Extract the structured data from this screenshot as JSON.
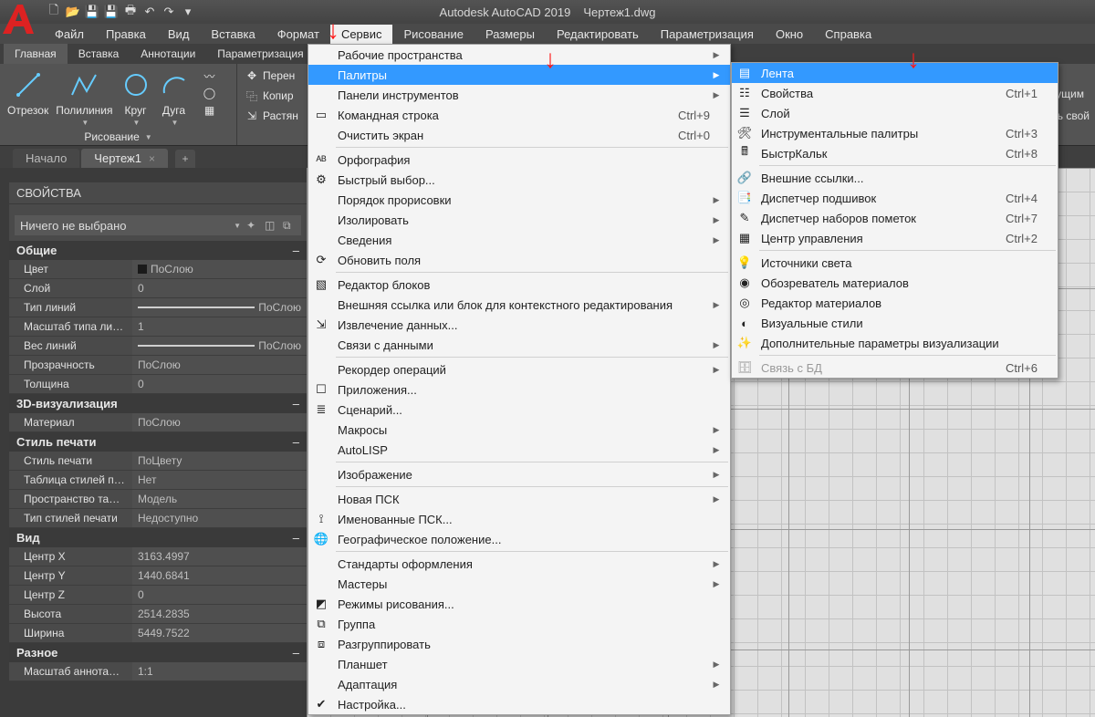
{
  "title": {
    "app": "Autodesk AutoCAD 2019",
    "file": "Чертеж1.dwg"
  },
  "menubar": [
    "Файл",
    "Правка",
    "Вид",
    "Вставка",
    "Формат",
    "Сервис",
    "Рисование",
    "Размеры",
    "Редактировать",
    "Параметризация",
    "Окно",
    "Справка"
  ],
  "menubar_open_index": 5,
  "ribtabs": [
    "Главная",
    "Вставка",
    "Аннотации",
    "Параметризация"
  ],
  "ribbon": {
    "draw": {
      "label": "Рисование",
      "buttons": [
        "Отрезок",
        "Полилиния",
        "Круг",
        "Дуга"
      ]
    },
    "modify": {
      "items": [
        "Перен",
        "Копир",
        "Растян"
      ]
    },
    "layers_hint1": "кущим",
    "layers_hint2": "ль свой"
  },
  "doctabs": {
    "start": "Начало",
    "active": "Чертеж1"
  },
  "props": {
    "title": "СВОЙСТВА",
    "selection": "Ничего не выбрано",
    "sections": {
      "general": "Общие",
      "vis3d": "3D-визуализация",
      "plot": "Стиль печати",
      "view": "Вид",
      "misc": "Разное"
    },
    "general_rows": [
      [
        "Цвет",
        "ПоСлою"
      ],
      [
        "Слой",
        "0"
      ],
      [
        "Тип линий",
        "ПоСлою"
      ],
      [
        "Масштаб типа линий",
        "1"
      ],
      [
        "Вес линий",
        "ПоСлою"
      ],
      [
        "Прозрачность",
        "ПоСлою"
      ],
      [
        "Толщина",
        "0"
      ]
    ],
    "vis3d_rows": [
      [
        "Материал",
        "ПоСлою"
      ]
    ],
    "plot_rows": [
      [
        "Стиль печати",
        "ПоЦвету"
      ],
      [
        "Таблица стилей печ...",
        "Нет"
      ],
      [
        "Пространство табл...",
        "Модель"
      ],
      [
        "Тип стилей печати",
        "Недоступно"
      ]
    ],
    "view_rows": [
      [
        "Центр X",
        "3163.4997"
      ],
      [
        "Центр Y",
        "1440.6841"
      ],
      [
        "Центр Z",
        "0"
      ],
      [
        "Высота",
        "2514.2835"
      ],
      [
        "Ширина",
        "5449.7522"
      ]
    ],
    "misc_rows": [
      [
        "Масштаб аннотаций",
        "1:1"
      ]
    ]
  },
  "dd1": [
    {
      "label": "Рабочие пространства",
      "arrow": true
    },
    {
      "label": "Палитры",
      "arrow": true,
      "hl": true
    },
    {
      "label": "Панели инструментов",
      "arrow": true
    },
    {
      "label": "Командная строка",
      "shortcut": "Ctrl+9",
      "icon": "cmd"
    },
    {
      "label": "Очистить экран",
      "shortcut": "Ctrl+0"
    },
    {
      "sep": true
    },
    {
      "label": "Орфография",
      "icon": "abc"
    },
    {
      "label": "Быстрый выбор...",
      "icon": "qsel"
    },
    {
      "label": "Порядок прорисовки",
      "arrow": true
    },
    {
      "label": "Изолировать",
      "arrow": true
    },
    {
      "label": "Сведения",
      "arrow": true
    },
    {
      "label": "Обновить поля",
      "icon": "refresh"
    },
    {
      "sep": true
    },
    {
      "label": "Редактор блоков",
      "icon": "block"
    },
    {
      "label": "Внешняя ссылка или блок для контекстного редактирования",
      "arrow": true
    },
    {
      "label": "Извлечение данных...",
      "icon": "extract"
    },
    {
      "label": "Связи с данными",
      "arrow": true
    },
    {
      "sep": true
    },
    {
      "label": "Рекордер операций",
      "arrow": true
    },
    {
      "label": "Приложения...",
      "icon": "apps"
    },
    {
      "label": "Сценарий...",
      "icon": "script"
    },
    {
      "label": "Макросы",
      "arrow": true
    },
    {
      "label": "AutoLISP",
      "arrow": true
    },
    {
      "sep": true
    },
    {
      "label": "Изображение",
      "arrow": true
    },
    {
      "sep": true
    },
    {
      "label": "Новая ПСК",
      "arrow": true
    },
    {
      "label": "Именованные ПСК...",
      "icon": "ucs"
    },
    {
      "label": "Географическое положение...",
      "icon": "globe"
    },
    {
      "sep": true
    },
    {
      "label": "Стандарты оформления",
      "arrow": true
    },
    {
      "label": "Мастеры",
      "arrow": true
    },
    {
      "label": "Режимы рисования...",
      "icon": "drawmode"
    },
    {
      "label": "Группа",
      "icon": "group"
    },
    {
      "label": "Разгруппировать",
      "icon": "ungroup"
    },
    {
      "label": "Планшет",
      "arrow": true
    },
    {
      "label": "Адаптация",
      "arrow": true
    },
    {
      "label": "Настройка...",
      "icon": "check"
    }
  ],
  "dd2": [
    {
      "label": "Лента",
      "hl": true,
      "icon": "ribbon"
    },
    {
      "label": "Свойства",
      "shortcut": "Ctrl+1",
      "icon": "props"
    },
    {
      "label": "Слой",
      "icon": "layers"
    },
    {
      "label": "Инструментальные палитры",
      "shortcut": "Ctrl+3",
      "icon": "tools"
    },
    {
      "label": "БыстрКальк",
      "shortcut": "Ctrl+8",
      "icon": "calc"
    },
    {
      "sep": true
    },
    {
      "label": "Внешние ссылки...",
      "icon": "xref"
    },
    {
      "label": "Диспетчер подшивок",
      "shortcut": "Ctrl+4",
      "icon": "sheets"
    },
    {
      "label": "Диспетчер наборов пометок",
      "shortcut": "Ctrl+7",
      "icon": "markups"
    },
    {
      "label": "Центр управления",
      "shortcut": "Ctrl+2",
      "icon": "dc"
    },
    {
      "sep": true
    },
    {
      "label": "Источники света",
      "icon": "light"
    },
    {
      "label": "Обозреватель материалов",
      "icon": "matbrowse"
    },
    {
      "label": "Редактор материалов",
      "icon": "matedit"
    },
    {
      "label": "Визуальные стили",
      "icon": "vstyle"
    },
    {
      "label": "Дополнительные параметры визуализации",
      "icon": "advvis"
    },
    {
      "sep": true
    },
    {
      "label": "Связь с БД",
      "shortcut": "Ctrl+6",
      "disabled": true,
      "icon": "db"
    }
  ]
}
